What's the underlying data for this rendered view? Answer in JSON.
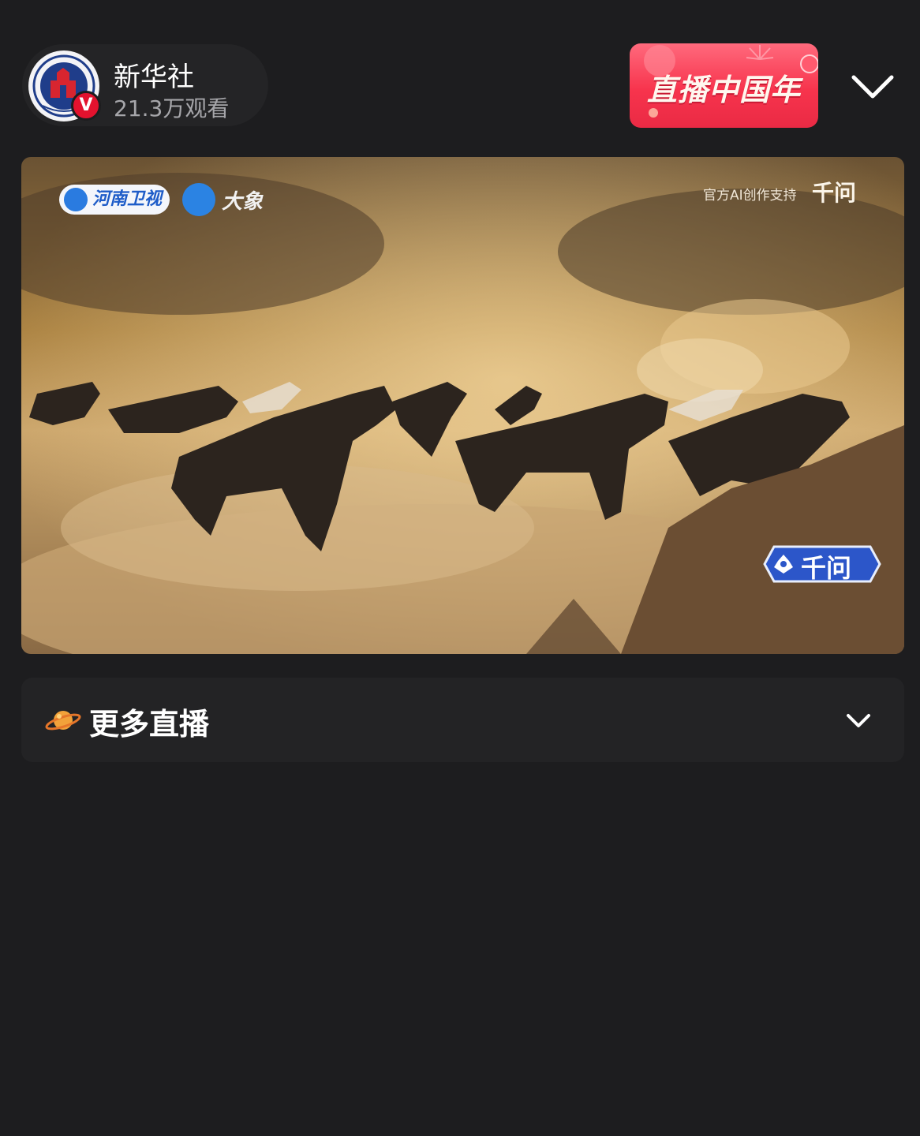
{
  "header": {
    "channel_name": "新华社",
    "viewers": "21.3万观看",
    "avatar_icon": "xinhua-logo",
    "verified_badge": "V",
    "promo_banner": "直播中国年",
    "collapse_icon": "chevron-down-icon"
  },
  "video": {
    "overlay_logo_1": "河南卫视",
    "overlay_logo_2": "大象",
    "support_text": "官方AI创作支持",
    "brand": "千问",
    "badge_text": "千问"
  },
  "more_live": {
    "label": "更多直播",
    "icon": "planet-icon",
    "expand_icon": "chevron-down-icon"
  },
  "colors": {
    "background": "#1d1d1f",
    "card": "#232325",
    "promo_red": "#f7344d",
    "verified_red": "#e3122e"
  }
}
